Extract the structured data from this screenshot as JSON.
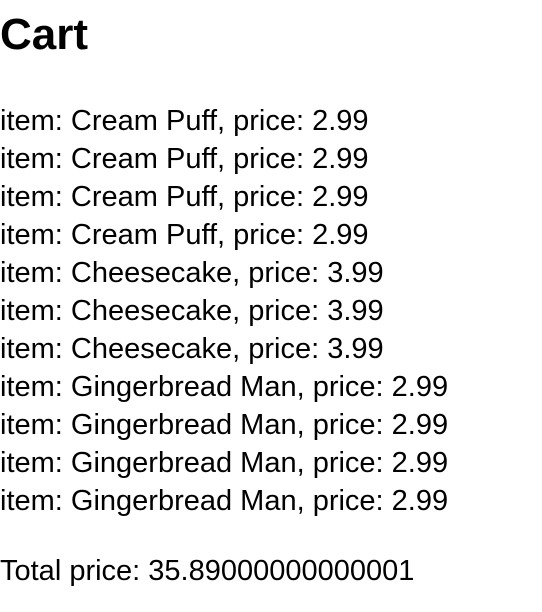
{
  "page_title": "Cart",
  "items": [
    "item: Cream Puff, price: 2.99",
    "item: Cream Puff, price: 2.99",
    "item: Cream Puff, price: 2.99",
    "item: Cream Puff, price: 2.99",
    "item: Cheesecake, price: 3.99",
    "item: Cheesecake, price: 3.99",
    "item: Cheesecake, price: 3.99",
    "item: Gingerbread Man, price: 2.99",
    "item: Gingerbread Man, price: 2.99",
    "item: Gingerbread Man, price: 2.99",
    "item: Gingerbread Man, price: 2.99"
  ],
  "total_text": "Total price: 35.89000000000001"
}
